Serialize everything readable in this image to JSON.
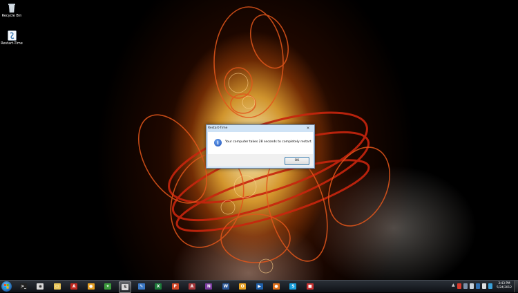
{
  "desktop": {
    "icons": [
      {
        "label": "Recycle Bin",
        "icon": "recycle-bin-icon"
      },
      {
        "label": "Restart-Time",
        "icon": "restart-time-app-icon"
      }
    ]
  },
  "dialog": {
    "title": "Restart-Time",
    "close_glyph": "×",
    "message": "Your computer takes 28 seconds to completely restart.",
    "icon": "information-icon",
    "ok_label": "OK"
  },
  "taskbar": {
    "start_icon": "windows-start-icon",
    "apps": [
      {
        "name": "command-prompt",
        "color": "#222222",
        "glyph": ">_"
      },
      {
        "name": "chrome",
        "color": "#d9d9d9",
        "glyph": "◉"
      },
      {
        "name": "explorer",
        "color": "#e8c65a",
        "glyph": "▭"
      },
      {
        "name": "acrobat",
        "color": "#c0281f",
        "glyph": "A"
      },
      {
        "name": "media-disc",
        "color": "#e6a024",
        "glyph": "●"
      },
      {
        "name": "utility-green",
        "color": "#3c9a3c",
        "glyph": "✦"
      },
      {
        "name": "restart-time",
        "color": "#d8d8d8",
        "glyph": "S"
      },
      {
        "name": "notepad",
        "color": "#3b78c4",
        "glyph": "✎"
      },
      {
        "name": "excel",
        "color": "#1d7a3a",
        "glyph": "X"
      },
      {
        "name": "powerpoint",
        "color": "#d24726",
        "glyph": "P"
      },
      {
        "name": "access",
        "color": "#a4373a",
        "glyph": "A"
      },
      {
        "name": "onenote",
        "color": "#7a3b9e",
        "glyph": "N"
      },
      {
        "name": "word",
        "color": "#2b5797",
        "glyph": "W"
      },
      {
        "name": "outlook",
        "color": "#e8a020",
        "glyph": "O"
      },
      {
        "name": "windows-media",
        "color": "#1f5fa8",
        "glyph": "▶"
      },
      {
        "name": "firefox",
        "color": "#e0701a",
        "glyph": "●"
      },
      {
        "name": "skype",
        "color": "#19a0dc",
        "glyph": "S"
      },
      {
        "name": "paint",
        "color": "#c83232",
        "glyph": "■"
      }
    ],
    "tray": {
      "icons": [
        "flag-icon",
        "network-icon",
        "volume-icon",
        "security-icon",
        "action-center-icon",
        "power-icon"
      ],
      "time": "3:43 PM",
      "date": "5/24/2012"
    }
  }
}
